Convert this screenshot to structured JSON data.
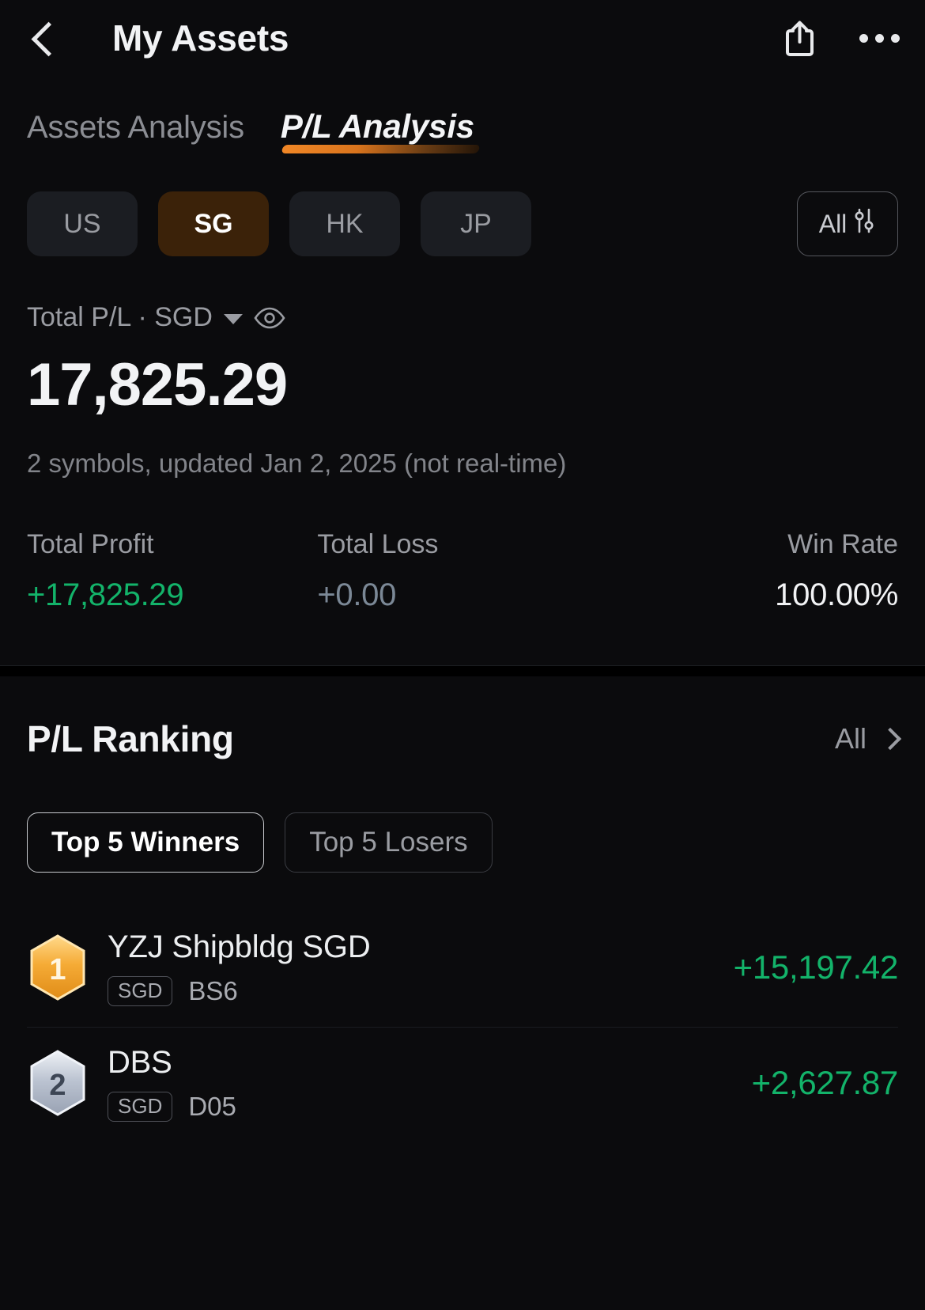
{
  "header": {
    "title": "My Assets",
    "back_icon": "chevron-left-icon",
    "share_icon": "share-icon",
    "more_icon": "more-horizontal-icon"
  },
  "tabs": [
    {
      "label": "Assets Analysis",
      "active": false
    },
    {
      "label": "P/L Analysis",
      "active": true
    }
  ],
  "markets": {
    "chips": [
      {
        "label": "US",
        "active": false
      },
      {
        "label": "SG",
        "active": true
      },
      {
        "label": "HK",
        "active": false
      },
      {
        "label": "JP",
        "active": false
      }
    ],
    "all_filter": {
      "label": "All",
      "icon": "sliders-icon"
    }
  },
  "summary": {
    "pl_label": "Total P/L · SGD",
    "caret_icon": "caret-down-icon",
    "eye_icon": "eye-icon",
    "pl_value": "17,825.29",
    "subtitle": "2 symbols, updated Jan 2, 2025 (not real-time)",
    "stats": [
      {
        "label": "Total Profit",
        "value": "+17,825.29",
        "tone": "profit"
      },
      {
        "label": "Total Loss",
        "value": "+0.00",
        "tone": "loss"
      },
      {
        "label": "Win Rate",
        "value": "100.00%",
        "tone": "neutral"
      }
    ]
  },
  "ranking": {
    "title": "P/L Ranking",
    "all_label": "All",
    "chevron_icon": "chevron-right-icon",
    "toggles": [
      {
        "label": "Top 5 Winners",
        "active": true
      },
      {
        "label": "Top 5 Losers",
        "active": false
      }
    ],
    "rows": [
      {
        "rank": "1",
        "medal": "gold-hex-medal-icon",
        "name": "YZJ Shipbldg SGD",
        "market": "SGD",
        "ticker": "BS6",
        "value": "+15,197.42"
      },
      {
        "rank": "2",
        "medal": "silver-hex-medal-icon",
        "name": "DBS",
        "market": "SGD",
        "ticker": "D05",
        "value": "+2,627.87"
      }
    ]
  },
  "colors": {
    "background": "#0b0b0d",
    "profit_green": "#13b36a",
    "accent_orange": "#f18726",
    "active_chip": "#3b2209",
    "muted_text": "#9a9ca2"
  }
}
